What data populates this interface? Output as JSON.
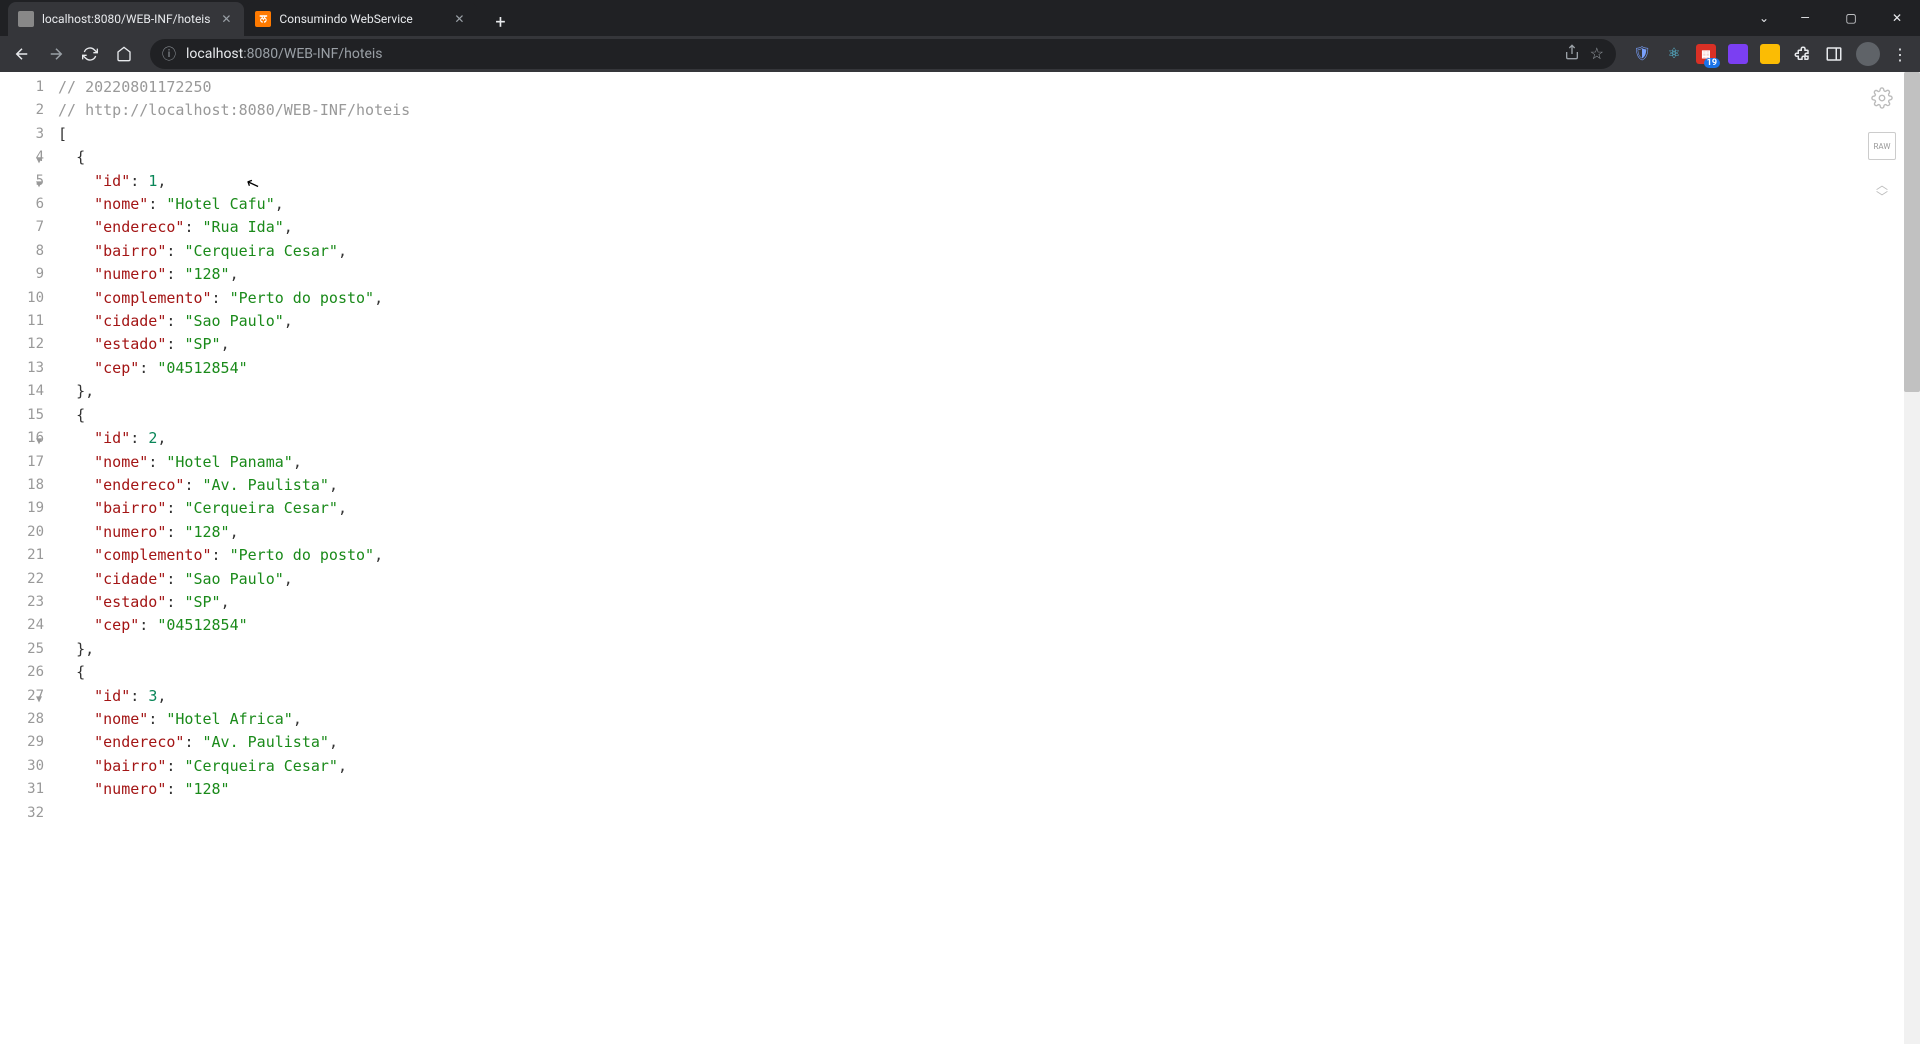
{
  "tabs": [
    {
      "title": "localhost:8080/WEB-INF/hoteis",
      "active": true
    },
    {
      "title": "Consumindo WebService",
      "active": false
    }
  ],
  "url": {
    "host": "localhost",
    "port": ":8080",
    "path": "/WEB-INF/hoteis"
  },
  "ext_badge": "19",
  "raw_label": "RAW",
  "code": {
    "l1": "// 20220801172250",
    "l2": "// http://localhost:8080/WEB-INF/hoteis",
    "open_bracket": "[",
    "open_brace": "{",
    "close_brace": "},",
    "keys": {
      "id": "\"id\"",
      "nome": "\"nome\"",
      "endereco": "\"endereco\"",
      "bairro": "\"bairro\"",
      "numero": "\"numero\"",
      "complemento": "\"complemento\"",
      "cidade": "\"cidade\"",
      "estado": "\"estado\"",
      "cep": "\"cep\""
    },
    "obj1": {
      "id": "1",
      "nome": "\"Hotel Cafu\"",
      "endereco": "\"Rua Ida\"",
      "bairro": "\"Cerqueira Cesar\"",
      "numero": "\"128\"",
      "complemento": "\"Perto do posto\"",
      "cidade": "\"Sao Paulo\"",
      "estado": "\"SP\"",
      "cep": "\"04512854\""
    },
    "obj2": {
      "id": "2",
      "nome": "\"Hotel Panama\"",
      "endereco": "\"Av. Paulista\"",
      "bairro": "\"Cerqueira Cesar\"",
      "numero": "\"128\"",
      "complemento": "\"Perto do posto\"",
      "cidade": "\"Sao Paulo\"",
      "estado": "\"SP\"",
      "cep": "\"04512854\""
    },
    "obj3": {
      "id": "3",
      "nome": "\"Hotel Africa\"",
      "endereco": "\"Av. Paulista\"",
      "bairro": "\"Cerqueira Cesar\"",
      "numero": "\"128\""
    }
  },
  "line_numbers": [
    "1",
    "2",
    "3",
    "4",
    "5",
    "6",
    "7",
    "8",
    "9",
    "10",
    "11",
    "12",
    "13",
    "14",
    "15",
    "16",
    "17",
    "18",
    "19",
    "20",
    "21",
    "22",
    "23",
    "24",
    "25",
    "26",
    "27",
    "28",
    "29",
    "30",
    "31",
    "32"
  ],
  "fold_lines": [
    4,
    5,
    16,
    27
  ]
}
